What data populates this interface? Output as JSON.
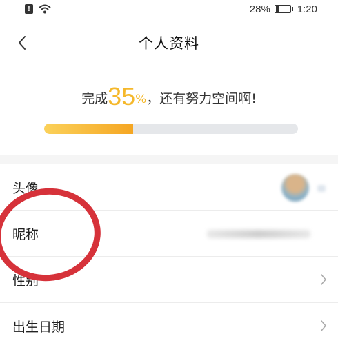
{
  "status_bar": {
    "alert_icon": "alert-icon",
    "wifi_icon": "wifi-icon",
    "battery_percent": "28%",
    "battery_level": 0.28,
    "time": "1:20"
  },
  "nav": {
    "back_icon": "chevron-left-icon",
    "title": "个人资料"
  },
  "progress": {
    "prefix": "完成",
    "percent_value": "35",
    "percent_sign": "%",
    "suffix": "，还有努力空间啊!",
    "fraction": 0.35,
    "accent_color": "#f5b82b",
    "track_color": "#e5e7ea"
  },
  "profile_rows": [
    {
      "label": "头像",
      "kind": "avatar"
    },
    {
      "label": "昵称",
      "kind": "nickname"
    },
    {
      "label": "性别",
      "kind": "chevron"
    },
    {
      "label": "出生日期",
      "kind": "chevron"
    }
  ],
  "annotation": {
    "color": "#d6323a"
  }
}
